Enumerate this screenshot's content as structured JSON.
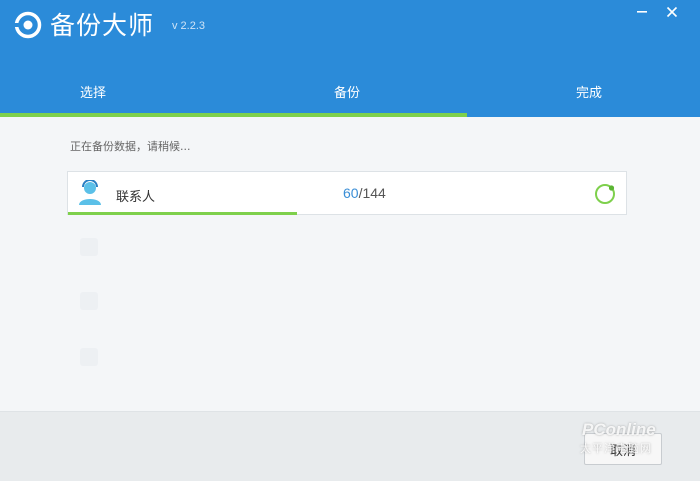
{
  "window": {
    "title": "备份大师",
    "version": "v 2.2.3",
    "minimize_icon": "minimize-icon",
    "close_icon": "close-icon"
  },
  "steps": {
    "items": [
      {
        "label": "选择"
      },
      {
        "label": "备份"
      },
      {
        "label": "完成"
      }
    ],
    "current_index": 1,
    "accent_color": "#7ed04c",
    "header_color": "#2b8bd9"
  },
  "main": {
    "status_text": "正在备份数据，请稍候...",
    "items": [
      {
        "icon": "contact-icon",
        "label": "联系人",
        "current": "60",
        "total": "/144",
        "progress": 0.42,
        "status_icon": "loading-spinner-icon"
      }
    ]
  },
  "footer": {
    "cancel_label": "取消"
  },
  "watermark": {
    "brand": "PConline",
    "sub": "太平洋电脑网"
  }
}
